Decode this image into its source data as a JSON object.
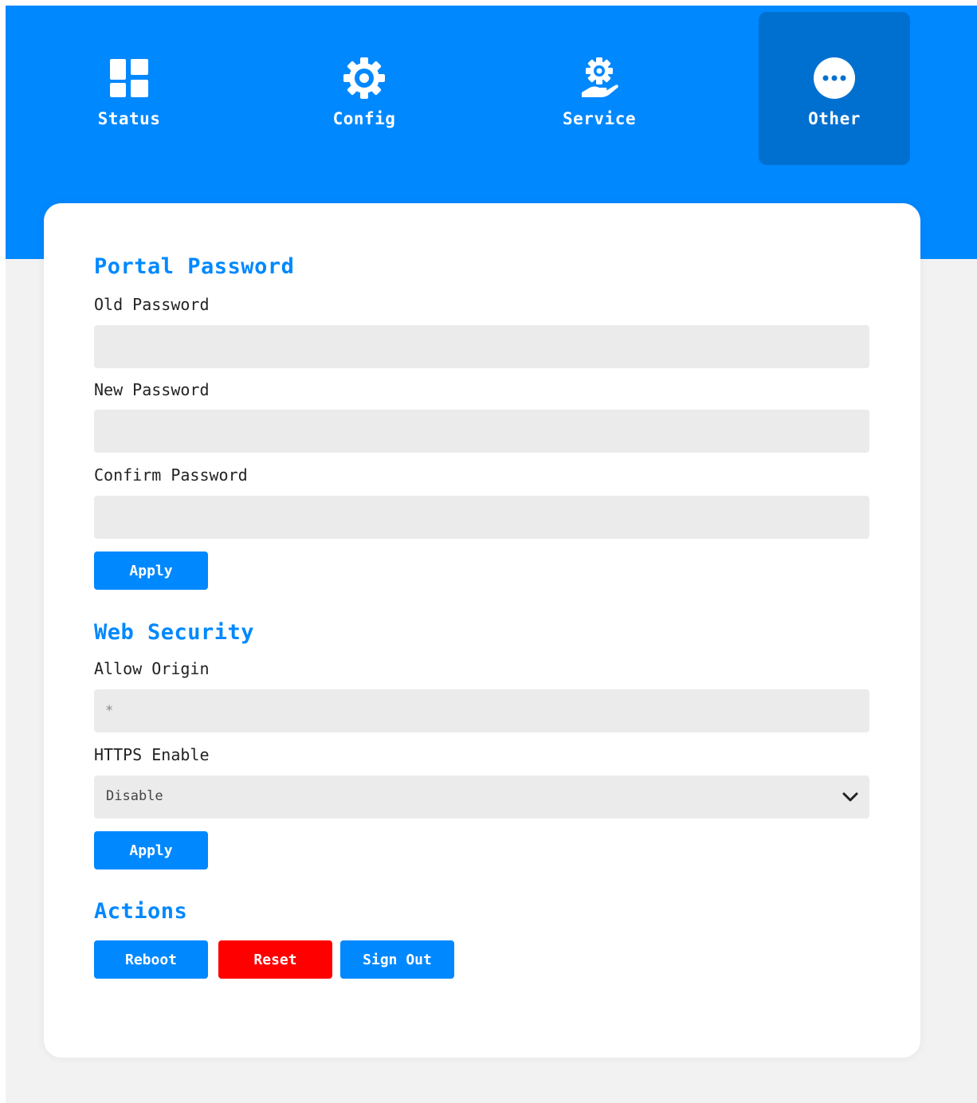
{
  "nav": {
    "items": [
      {
        "label": "Status",
        "icon": "dashboard-icon",
        "active": false
      },
      {
        "label": "Config",
        "icon": "gear-icon",
        "active": false
      },
      {
        "label": "Service",
        "icon": "service-hand-gear-icon",
        "active": false
      },
      {
        "label": "Other",
        "icon": "more-dots-icon",
        "active": true
      }
    ]
  },
  "portal_password": {
    "title": "Portal Password",
    "old_label": "Old Password",
    "old_value": "",
    "new_label": "New Password",
    "new_value": "",
    "confirm_label": "Confirm Password",
    "confirm_value": "",
    "apply_label": "Apply"
  },
  "web_security": {
    "title": "Web Security",
    "allow_origin_label": "Allow Origin",
    "allow_origin_placeholder": "*",
    "allow_origin_value": "",
    "https_label": "HTTPS Enable",
    "https_value": "Disable",
    "apply_label": "Apply"
  },
  "actions": {
    "title": "Actions",
    "reboot_label": "Reboot",
    "reset_label": "Reset",
    "signout_label": "Sign Out"
  },
  "colors": {
    "primary": "#0088ff",
    "primary_active": "#0070d0",
    "danger": "#ff0000",
    "page_bg": "#f2f2f2",
    "input_bg": "#ebebeb"
  }
}
